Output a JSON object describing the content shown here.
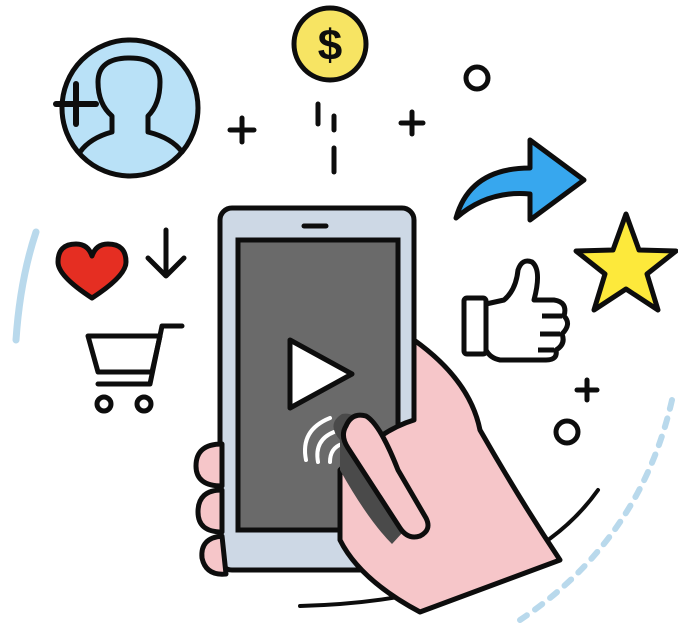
{
  "illustration": {
    "coin_symbol": "$",
    "colors": {
      "outline": "#0d0d0d",
      "avatar_fill": "#b9e1f7",
      "coin_fill": "#f7e463",
      "share_arrow_fill": "#37a7ee",
      "star_fill": "#fde93b",
      "heart_fill": "#e52e22",
      "phone_body": "#cdd8e5",
      "phone_screen": "#6a6a6a",
      "hand_skin": "#f6c6c9",
      "decor_arc": "#b9d9ec"
    },
    "icons": [
      "add-user-icon",
      "dollar-coin-icon",
      "share-arrow-icon",
      "star-icon",
      "thumbs-up-icon",
      "heart-icon",
      "down-arrow-icon",
      "shopping-cart-icon",
      "play-icon",
      "tap-icon"
    ]
  }
}
